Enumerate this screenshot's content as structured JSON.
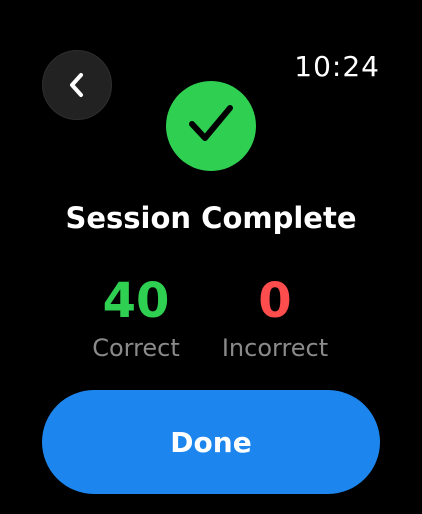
{
  "status_bar": {
    "time": "10:24"
  },
  "back_button": {
    "icon": "chevron-left-icon"
  },
  "result": {
    "icon": "checkmark-icon",
    "title": "Session Complete",
    "correct": {
      "value": "40",
      "label": "Correct",
      "color": "#2fcf52"
    },
    "incorrect": {
      "value": "0",
      "label": "Incorrect",
      "color": "#ff4d4d"
    }
  },
  "actions": {
    "done_label": "Done"
  },
  "colors": {
    "background": "#000000",
    "success": "#2fcf52",
    "primary_button": "#1c86ee",
    "muted_text": "#8a8a8a"
  }
}
